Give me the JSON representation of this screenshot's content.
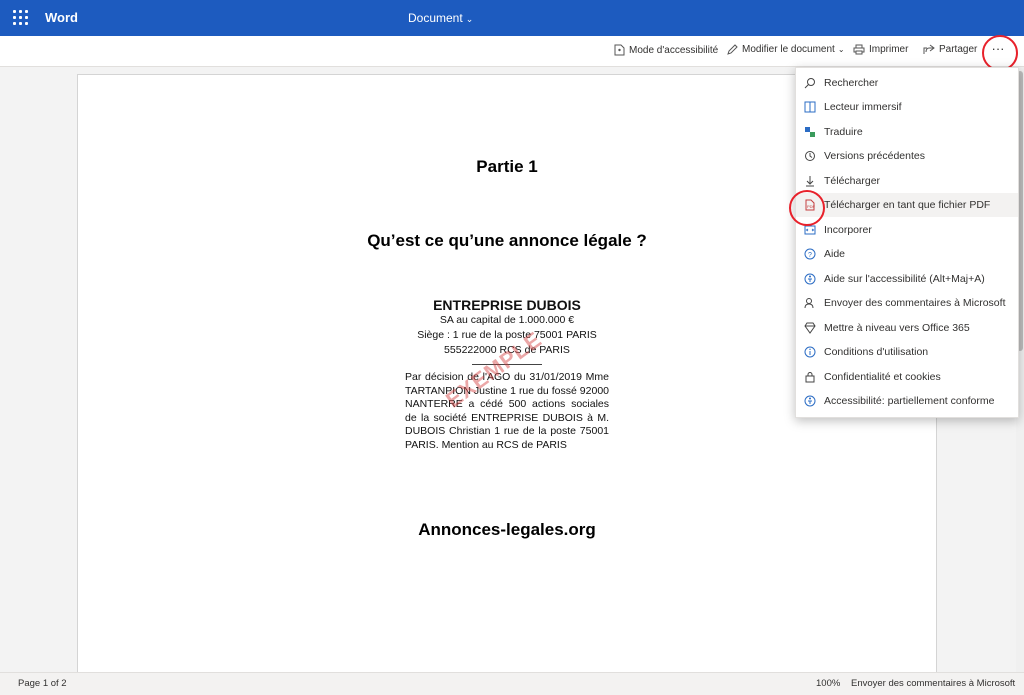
{
  "titlebar": {
    "app_name": "Word",
    "doc_title": "Document"
  },
  "commandbar": {
    "accessibility_mode": "Mode d'accessibilité",
    "edit_document": "Modifier le document",
    "print": "Imprimer",
    "share": "Partager",
    "more": "···"
  },
  "menu": {
    "items": [
      {
        "label": "Rechercher",
        "icon": "search-icon"
      },
      {
        "label": "Lecteur immersif",
        "icon": "immersive-reader-icon"
      },
      {
        "label": "Traduire",
        "icon": "translate-icon"
      },
      {
        "label": "Versions précédentes",
        "icon": "history-icon"
      },
      {
        "label": "Télécharger",
        "icon": "download-icon"
      },
      {
        "label": "Télécharger en tant que fichier PDF",
        "icon": "pdf-icon"
      },
      {
        "label": "Incorporer",
        "icon": "embed-icon"
      },
      {
        "label": "Aide",
        "icon": "help-icon"
      },
      {
        "label": "Aide sur l'accessibilité (Alt+Maj+A)",
        "icon": "accessibility-help-icon"
      },
      {
        "label": "Envoyer des commentaires à Microsoft",
        "icon": "feedback-icon"
      },
      {
        "label": "Mettre à niveau vers Office 365",
        "icon": "diamond-icon"
      },
      {
        "label": "Conditions d'utilisation",
        "icon": "info-icon"
      },
      {
        "label": "Confidentialité et cookies",
        "icon": "lock-icon"
      },
      {
        "label": "Accessibilité: partiellement conforme",
        "icon": "accessibility-icon"
      }
    ]
  },
  "document": {
    "part_heading": "Partie 1",
    "question_heading": "Qu’est ce qu’une annonce légale ?",
    "notice": {
      "company": "ENTREPRISE DUBOIS",
      "capital": "SA au capital de 1.000.000 €",
      "seat": "Siège : 1 rue de la poste 75001 PARIS",
      "rcs": "555222000 RCS de PARIS",
      "body": "Par décision de l'AGO du 31/01/2019 Mme TARTANPION Justine 1 rue du fossé 92000 NANTERRE a cédé 500 actions sociales de la société ENTREPRISE DUBOIS à M. DUBOIS Christian 1 rue de la poste 75001 PARIS. Mention au RCS de PARIS"
    },
    "watermark": "EXEMPLE",
    "site_heading": "Annonces-legales.org"
  },
  "statusbar": {
    "page": "Page 1 of 2",
    "zoom": "100%",
    "feedback": "Envoyer des commentaires à Microsoft"
  },
  "colors": {
    "titlebar": "#1d5bbf",
    "annotation": "#e8212b"
  }
}
